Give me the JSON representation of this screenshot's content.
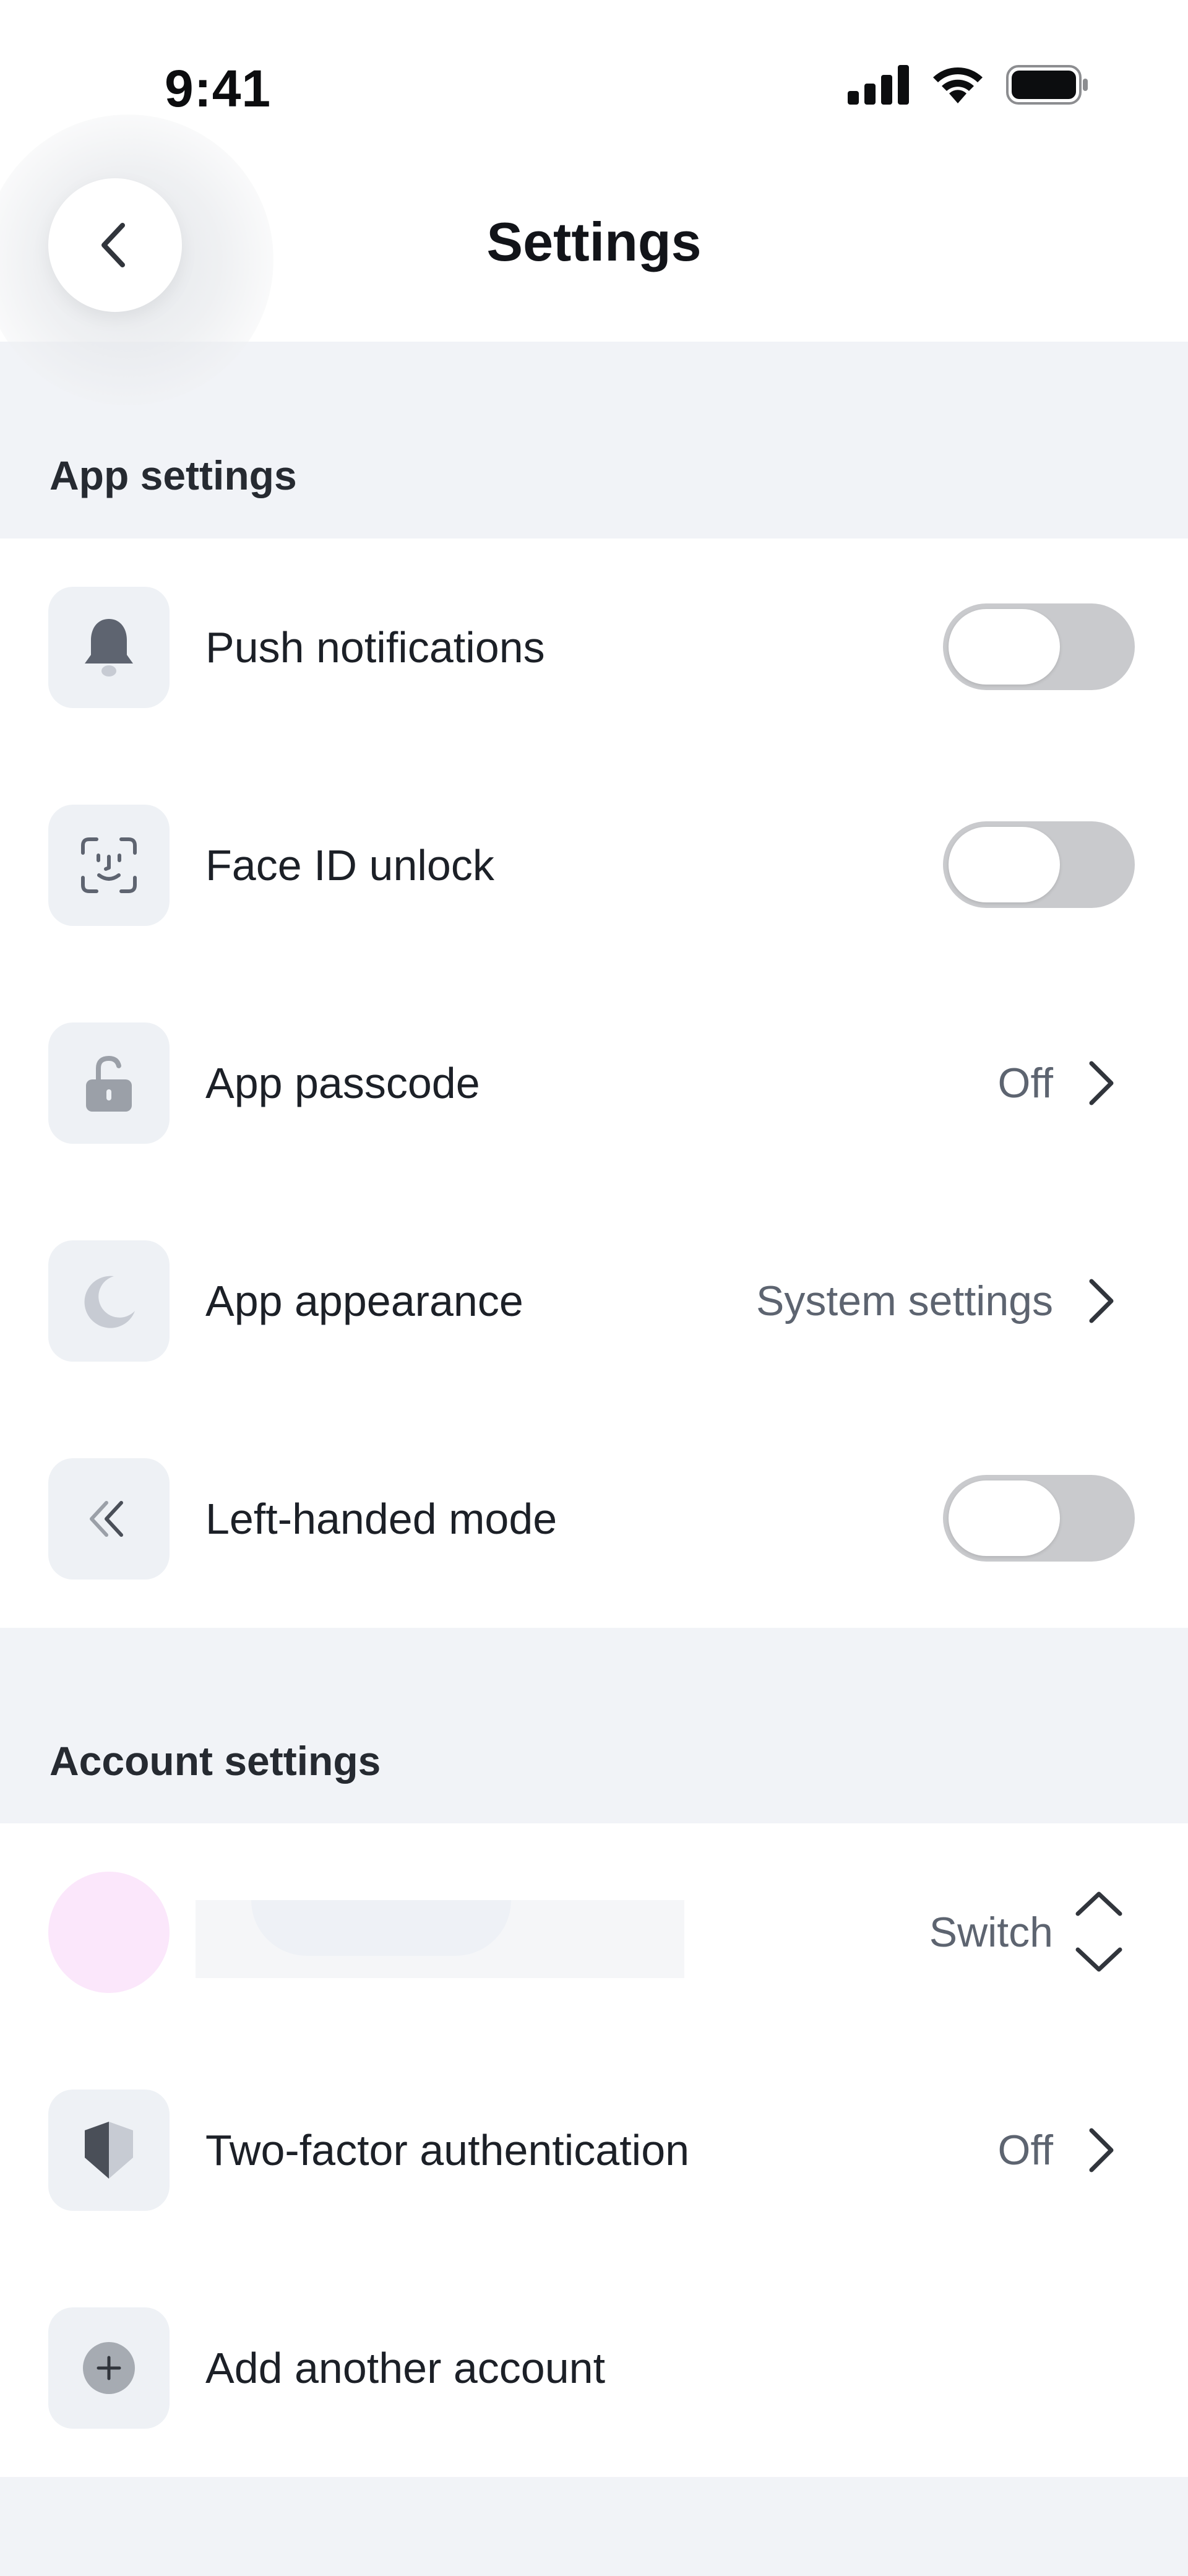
{
  "status_bar": {
    "time": "9:41",
    "icons": [
      "cellular-signal-icon",
      "wifi-icon",
      "battery-icon"
    ]
  },
  "header": {
    "title": "Settings",
    "back_icon": "chevron-left-icon"
  },
  "app_settings": {
    "heading": "App settings",
    "items": [
      {
        "label": "Push notifications",
        "icon": "bell-icon",
        "control": "toggle",
        "on": false
      },
      {
        "label": "Face ID unlock",
        "icon": "face-id-icon",
        "control": "toggle",
        "on": false
      },
      {
        "label": "App passcode",
        "icon": "unlocked-padlock-icon",
        "control": "value",
        "value": "Off"
      },
      {
        "label": "App appearance",
        "icon": "moon-icon",
        "control": "value",
        "value": "System settings"
      },
      {
        "label": "Left-handed mode",
        "icon": "double-chevron-left-icon",
        "control": "toggle",
        "on": false
      }
    ]
  },
  "account_settings": {
    "heading": "Account settings",
    "account_row": {
      "switch_label": "Switch",
      "icon": "chevron-up-down-icon"
    },
    "items": [
      {
        "label": "Two-factor authentication",
        "icon": "half-shield-icon",
        "control": "value",
        "value": "Off"
      },
      {
        "label": "Add another account",
        "icon": "plus-circle-icon",
        "control": "none"
      }
    ]
  },
  "colors": {
    "page_background": "#f1f3f7",
    "card_background": "#ffffff",
    "icon_tile": "#eef1f5",
    "toggle_off": "#c9cacd",
    "secondary_text": "#5d6470",
    "avatar": "#fbe7fb"
  }
}
